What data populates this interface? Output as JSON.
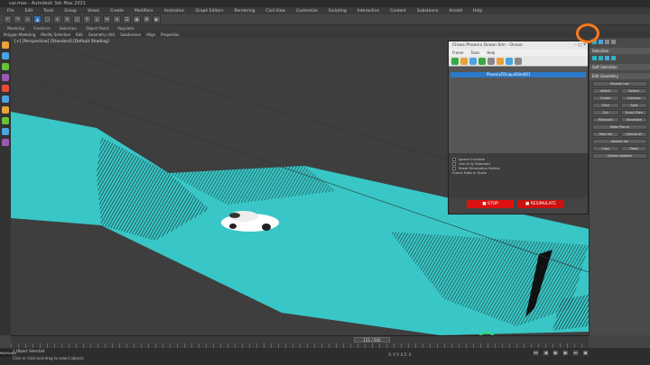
{
  "window": {
    "title": "car.max - Autodesk 3ds Max 2021"
  },
  "menu": [
    "File",
    "Edit",
    "Tools",
    "Group",
    "Views",
    "Create",
    "Modifiers",
    "Animation",
    "Graph Editors",
    "Rendering",
    "Civil View",
    "Customize",
    "Scripting",
    "Interactive",
    "Content",
    "Substance",
    "Arnold",
    "Help"
  ],
  "workspace_tabs": [
    "Modeling",
    "Freeform",
    "Selection",
    "Object Paint",
    "Populate"
  ],
  "ribbon_items": [
    "Polygon Modeling",
    "Modify Selection",
    "Edit",
    "Geometry (All)",
    "Subdivision",
    "Align",
    "Properties"
  ],
  "viewport": {
    "label": "[+] [Perspective] [Standard] [Default Shading]"
  },
  "chaos": {
    "title": "Chaos Phoenix Ocean Sim - Ocean",
    "menu": [
      "Frame",
      "Tools",
      "Help"
    ],
    "list_item": "PhoenixFDLiquidSim001",
    "options": [
      "Ignore Invisible",
      "Use Only Selected",
      "Reset Simulation Button"
    ],
    "playback_label": "Frame Rate in Scale",
    "stop_label": "STOP",
    "resimulate_label": "RESIMULATE"
  },
  "panel": {
    "head1": "Selection",
    "head2": "Soft Selection",
    "head3": "Edit Geometry",
    "buttons": [
      "Repeat Last",
      "Attach",
      "Detach",
      "Create",
      "Collapse",
      "Slice",
      "Split",
      "Cut",
      "Quick Slice",
      "MSmooth",
      "Tessellate",
      "Make Planar",
      "Hide Sel",
      "Unhide All",
      "Named Sel",
      "Copy",
      "Paste",
      "Delete Isolated"
    ]
  },
  "timeline": {
    "frame": "151 / 500"
  },
  "status": {
    "selection": "1 Object Selected",
    "prompt": "Click or click-and-drag to select objects",
    "coords": "X: 0   Y: 0   Z: 0",
    "maxscript": "MAXScript"
  },
  "colors": {
    "ocean": "#39c6c6",
    "stop": "#dd1111",
    "highlight": "#ff7a1a",
    "cursor": "#2fdc7a",
    "select_blue": "#2a79c8"
  },
  "icons": [
    "undo-icon",
    "redo-icon",
    "select-icon",
    "move-icon",
    "rotate-icon",
    "scale-icon",
    "snap-icon",
    "render-icon",
    "car-icon",
    "stop-icon"
  ]
}
